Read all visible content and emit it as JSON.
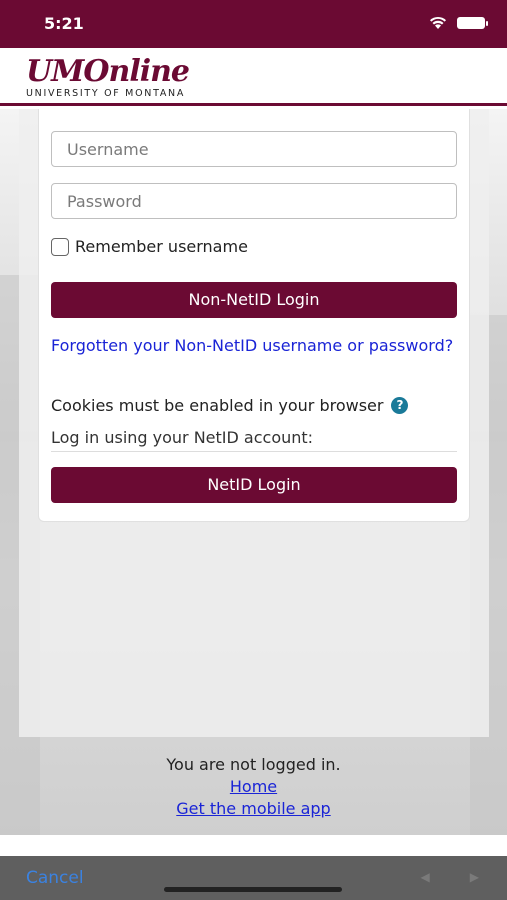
{
  "status_bar": {
    "time": "5:21"
  },
  "header": {
    "logo_main": "UMOnline",
    "logo_sub": "UNIVERSITY OF MONTANA"
  },
  "form": {
    "username_placeholder": "Username",
    "password_placeholder": "Password",
    "remember_label": "Remember username",
    "nonnetid_button": "Non-NetID Login",
    "forgot_link": "Forgotten your Non-NetID username or password?",
    "cookies_text": "Cookies must be enabled in your browser",
    "netid_prompt": "Log in using your NetID account:",
    "netid_button": "NetID Login"
  },
  "footer": {
    "status": "You are not logged in.",
    "home_link": "Home",
    "app_link": "Get the mobile app"
  },
  "bottom_bar": {
    "cancel": "Cancel"
  }
}
